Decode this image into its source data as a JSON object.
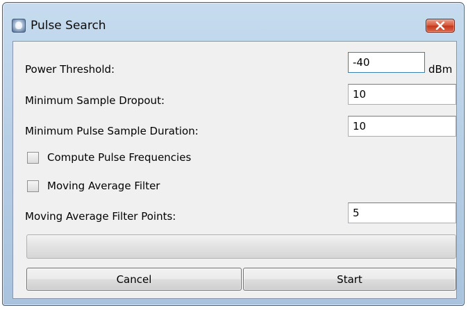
{
  "window": {
    "title": "Pulse Search",
    "close_label": "×"
  },
  "form": {
    "power_threshold": {
      "label": "Power Threshold:",
      "value": "-40",
      "unit": "dBm"
    },
    "min_sample_dropout": {
      "label": "Minimum Sample Dropout:",
      "value": "10"
    },
    "min_pulse_sample_duration": {
      "label": "Minimum Pulse Sample Duration:",
      "value": "10"
    },
    "compute_pulse_frequencies": {
      "label": "Compute Pulse Frequencies",
      "checked": false
    },
    "moving_average_filter": {
      "label": "Moving Average Filter",
      "checked": false
    },
    "moving_average_filter_points": {
      "label": "Moving Average Filter Points:",
      "value": "5"
    }
  },
  "progress": {
    "percent": 0
  },
  "buttons": {
    "cancel": "Cancel",
    "start": "Start"
  },
  "colors": {
    "titlebar": "#b7cfe6",
    "close_button": "#d7583b",
    "dialog_background": "#f0f0f0",
    "focused_field_border": "#3c7fb1"
  },
  "icons": {
    "app": "app-icon",
    "close": "close-icon"
  }
}
